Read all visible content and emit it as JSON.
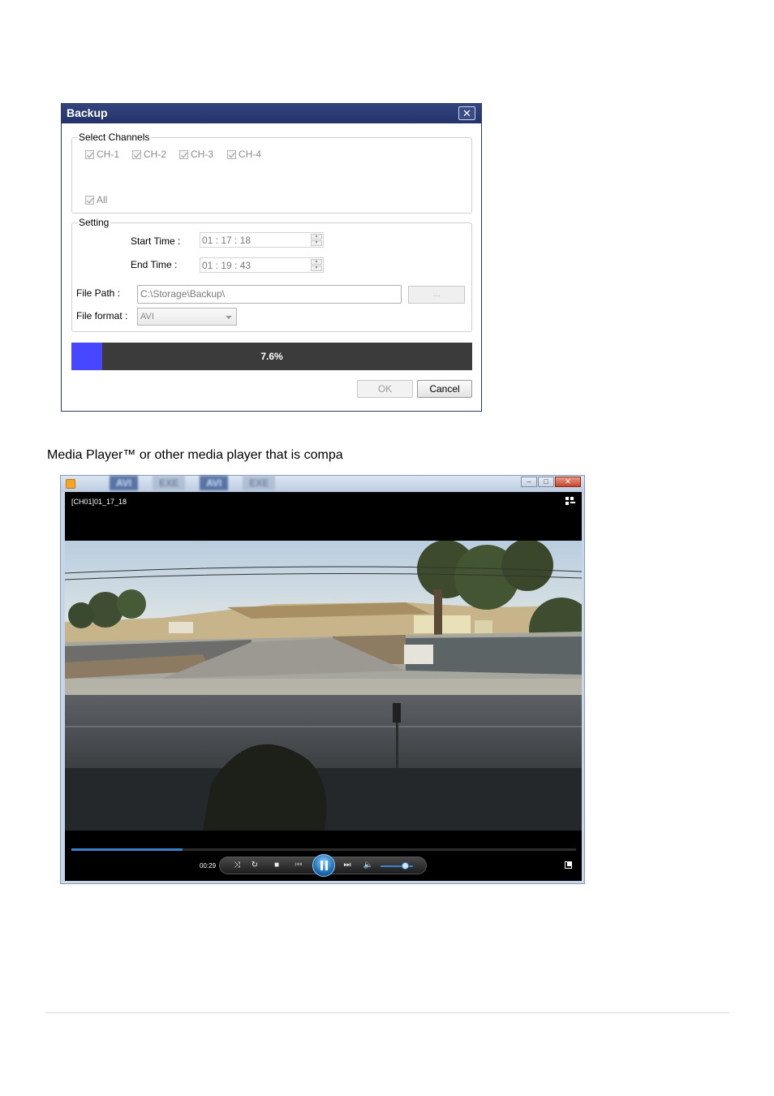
{
  "backup_dialog": {
    "title": "Backup",
    "close_glyph": "✕",
    "select_channels": {
      "label": "Select Channels",
      "channels": [
        "CH-1",
        "CH-2",
        "CH-3",
        "CH-4"
      ],
      "all_label": "All"
    },
    "setting": {
      "label": "Setting",
      "start_time_label": "Start Time :",
      "start_time_value": "01 : 17 : 18",
      "end_time_label": "End Time :",
      "end_time_value": "01 : 19 : 43"
    },
    "file_path_label": "File Path :",
    "file_path_value": "C:\\Storage\\Backup\\",
    "browse_label": "...",
    "file_format_label": "File format :",
    "file_format_value": "AVI",
    "progress": {
      "percent": 7.6,
      "text": "7.6%",
      "fill_color": "#4747ff"
    },
    "ok_label": "OK",
    "cancel_label": "Cancel"
  },
  "caption": "Media Player™ or other media player that is compa",
  "media_player": {
    "background_tabs": [
      "AVI",
      "EXE",
      "AVI",
      "EXE"
    ],
    "window_buttons": {
      "minimize": "–",
      "maximize": "□",
      "close": "✕"
    },
    "file_name": "[CH01]01_17_18",
    "current_time": "00:29",
    "seek_progress_fraction": 0.22,
    "volume_fraction": 0.75,
    "icons": [
      "switch-to-library-icon",
      "shuffle-icon",
      "repeat-icon",
      "stop-icon",
      "previous-icon",
      "pause-icon",
      "next-icon",
      "volume-icon",
      "fullscreen-icon"
    ]
  }
}
